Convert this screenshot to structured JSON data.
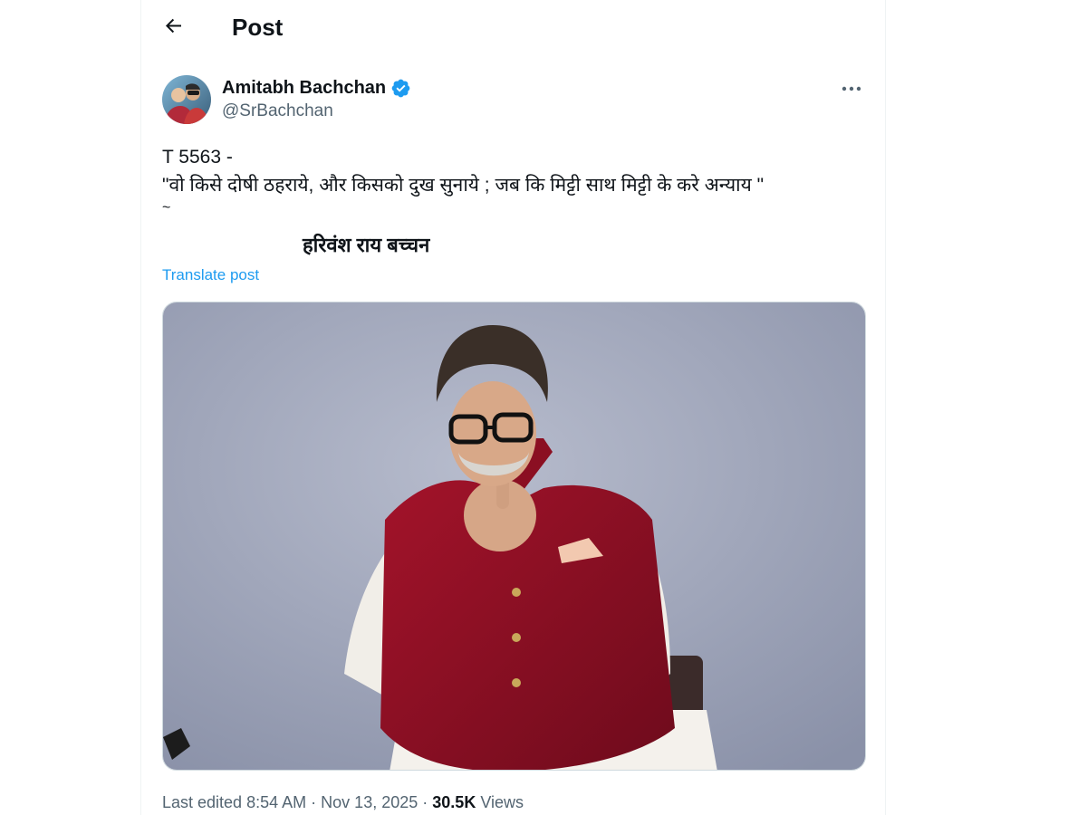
{
  "header": {
    "title": "Post"
  },
  "author": {
    "display_name": "Amitabh Bachchan",
    "handle": "@SrBachchan",
    "verified": true
  },
  "post": {
    "lines": [
      "T 5563 -",
      "\"वो किसे दोषी ठहराये, और किसको दुख सुनाये  ; जब कि मिट्टी साथ मिट्टी के करे अन्याय \"",
      "~"
    ],
    "poet": "हरिवंश राय बच्चन",
    "translate_label": "Translate post"
  },
  "meta": {
    "edited_label": "Last edited",
    "time": "8:54 AM",
    "date": "Nov 13, 2025",
    "separator": "·",
    "views_count": "30.5K",
    "views_label": "Views"
  },
  "colors": {
    "accent": "#1d9bf0",
    "secondary_text": "#536471",
    "primary_text": "#0f1419"
  },
  "icons": {
    "back": "arrow-left-icon",
    "verified": "verified-badge-icon",
    "more": "more-horizontal-icon"
  }
}
